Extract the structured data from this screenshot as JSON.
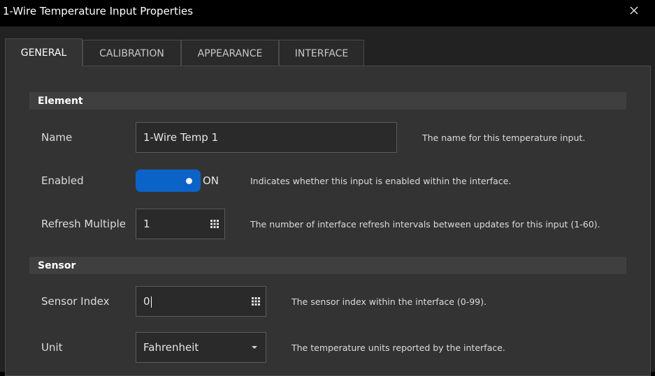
{
  "window": {
    "title": "1-Wire Temperature Input Properties"
  },
  "tabs": [
    {
      "label": "GENERAL",
      "active": true
    },
    {
      "label": "CALIBRATION",
      "active": false
    },
    {
      "label": "APPEARANCE",
      "active": false
    },
    {
      "label": "INTERFACE",
      "active": false
    }
  ],
  "sections": {
    "element": "Element",
    "sensor": "Sensor"
  },
  "fields": {
    "name": {
      "label": "Name",
      "value": "1-Wire Temp 1",
      "help": "The name for this temperature input."
    },
    "enabled": {
      "label": "Enabled",
      "state": "ON",
      "help": "Indicates whether this input is enabled within the interface."
    },
    "refresh_multiple": {
      "label": "Refresh Multiple",
      "value": "1",
      "help": "The number of interface refresh intervals between updates for this input (1-60)."
    },
    "sensor_index": {
      "label": "Sensor Index",
      "value": "0",
      "help": "The sensor index within the interface (0-99)."
    },
    "unit": {
      "label": "Unit",
      "value": "Fahrenheit",
      "help": "The temperature units reported by the interface."
    }
  },
  "icons": {
    "close": "close-icon",
    "stepper": "keypad-grid-icon",
    "dropdown": "chevron-down-icon"
  },
  "colors": {
    "toggle_on": "#0b63c8",
    "panel": "#333333",
    "section_header": "#3f3f3f"
  }
}
